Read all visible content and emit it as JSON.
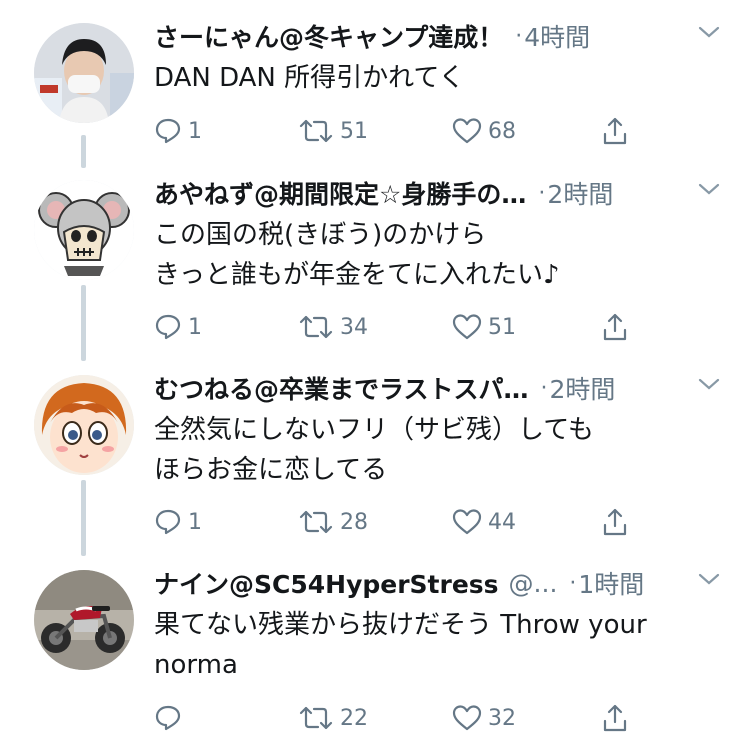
{
  "tweets": [
    {
      "display_name": "さーにゃん@冬キャンプ達成！",
      "handle": "",
      "time": "4時間",
      "text": "DAN DAN 所得引かれてく",
      "reply_count": "1",
      "retweet_count": "51",
      "like_count": "68",
      "avatar": "person-with-mask-avatar"
    },
    {
      "display_name": "あやねず@期間限定☆身勝手の…",
      "handle": "",
      "time": "2時間",
      "text": "この国の税(きぼう)のかけら\nきっと誰もが年金をてに入れたい♪",
      "reply_count": "1",
      "retweet_count": "34",
      "like_count": "51",
      "avatar": "skull-mouse-avatar"
    },
    {
      "display_name": "むつねる@卒業までラストスパ…",
      "handle": "",
      "time": "2時間",
      "text": "全然気にしないフリ（サビ残）しても\nほらお金に恋してる",
      "reply_count": "1",
      "retweet_count": "28",
      "like_count": "44",
      "avatar": "anime-girl-avatar"
    },
    {
      "display_name": "ナイン@SC54HyperStress",
      "handle": "@...",
      "time": "1時間",
      "text": "果てない残業から抜けだそう Throw your\nnorma",
      "reply_count": "",
      "retweet_count": "22",
      "like_count": "32",
      "avatar": "motorcycle-avatar"
    }
  ],
  "colors": {
    "text": "#14171a",
    "secondary": "#657786",
    "thread_line": "#ccd6dd"
  }
}
